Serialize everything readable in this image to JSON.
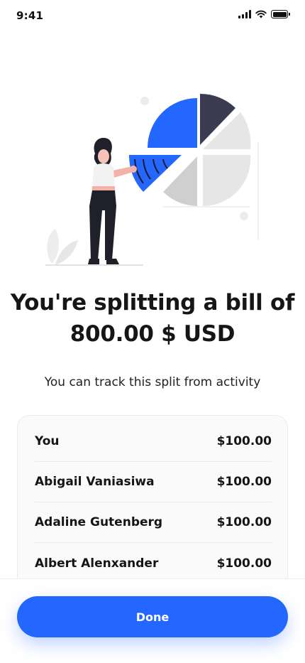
{
  "status_bar": {
    "time": "9:41"
  },
  "colors": {
    "accent": "#2467ff",
    "dark_slice": "#3b3b52",
    "light_slice": "#e6e6e6",
    "grey_slice": "#cfcfcf"
  },
  "illustration": {
    "icon": "person-splitting-pie-chart-illustration"
  },
  "headline": {
    "line1": "You're splitting a bill of",
    "line2": "800.00 $ USD"
  },
  "subtitle": "You can track this split from activity",
  "split": {
    "rows": [
      {
        "name": "You",
        "amount": "$100.00"
      },
      {
        "name": "Abigail Vaniasiwa",
        "amount": "$100.00"
      },
      {
        "name": "Adaline Gutenberg",
        "amount": "$100.00"
      },
      {
        "name": "Albert Alenxander",
        "amount": "$100.00"
      }
    ]
  },
  "actions": {
    "done_label": "Done"
  }
}
